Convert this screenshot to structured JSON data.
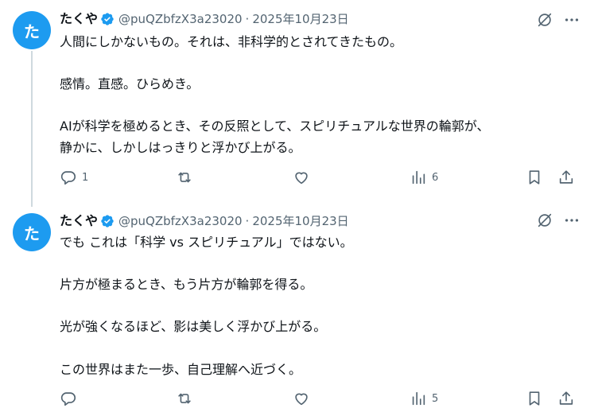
{
  "posts": [
    {
      "avatar_text": "た",
      "name": "たくや",
      "handle": "@puQZbfzX3a23020",
      "dot": "·",
      "date": "2025年10月23日",
      "lines": [
        "人間にしかないもの。それは、非科学的とされてきたもの。",
        "",
        "感情。直感。ひらめき。",
        "",
        "AIが科学を極めるとき、その反照として、スピリチュアルな世界の輪郭が、",
        "静かに、しかしはっきりと浮かび上がる。"
      ],
      "replies": "1",
      "reposts": "",
      "likes": "",
      "views": "6"
    },
    {
      "avatar_text": "た",
      "name": "たくや",
      "handle": "@puQZbfzX3a23020",
      "dot": "·",
      "date": "2025年10月23日",
      "lines": [
        "でも これは「科学 vs スピリチュアル」ではない。",
        "",
        "片方が極まるとき、もう片方が輪郭を得る。",
        "",
        "光が強くなるほど、影は美しく浮かび上がる。",
        "",
        "この世界はまた一歩、自己理解へ近づく。"
      ],
      "replies": "",
      "reposts": "",
      "likes": "",
      "views": "5"
    }
  ],
  "icons": {
    "verified": "verified-badge-icon",
    "grok": "grok-icon",
    "more": "more-icon",
    "reply": "reply-icon",
    "repost": "repost-icon",
    "like": "like-icon",
    "views": "views-icon",
    "bookmark": "bookmark-icon",
    "share": "share-icon"
  },
  "colors": {
    "accent": "#1d9bf0",
    "text": "#0f1419",
    "muted": "#536471",
    "thread_line": "#cfd9de"
  }
}
